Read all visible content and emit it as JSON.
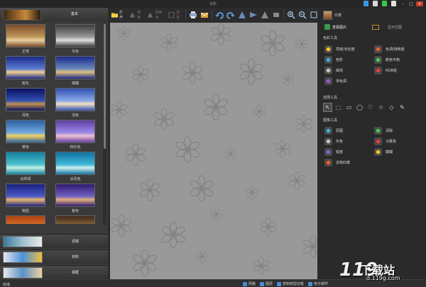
{
  "app": {
    "title": "光影"
  },
  "skin_icons": [
    "#3a9ad8",
    "#d8d8d8",
    "#3ac848",
    "#e0e0e0"
  ],
  "left_panel": {
    "header_label": "基本",
    "presets": [
      {
        "label": "正常",
        "colors": [
          "#7a4a2a",
          "#c0985a",
          "#e8d0a0"
        ]
      },
      {
        "label": "灰色",
        "colors": [
          "#3a3a3a",
          "#9a9a9a",
          "#e0e0e0"
        ]
      },
      {
        "label": "锐化",
        "colors": [
          "#1a2a8a",
          "#5a7ad0",
          "#f0d090"
        ]
      },
      {
        "label": "模糊",
        "colors": [
          "#1a2a8a",
          "#6a8ac0",
          "#e0c080"
        ]
      },
      {
        "label": "深色",
        "colors": [
          "#0a1060",
          "#3050b0",
          "#c09050"
        ]
      },
      {
        "label": "浅色",
        "colors": [
          "#3050b0",
          "#8aa8e8",
          "#f0e0c0"
        ]
      },
      {
        "label": "黄色",
        "colors": [
          "#2a60a0",
          "#70a8e0",
          "#f0d060"
        ]
      },
      {
        "label": "粉红色",
        "colors": [
          "#6040a0",
          "#9a88e8",
          "#f0c0d0"
        ]
      },
      {
        "label": "淡草绿",
        "colors": [
          "#1080a0",
          "#50c0d0",
          "#c0f0e0"
        ]
      },
      {
        "label": "淡青色",
        "colors": [
          "#1070a0",
          "#40b8d8",
          "#d0f0f0"
        ]
      },
      {
        "label": "稍蓝",
        "colors": [
          "#1a2080",
          "#4a5ac8",
          "#e8b870"
        ]
      },
      {
        "label": "紫色",
        "colors": [
          "#301a70",
          "#7060c0",
          "#e0b080"
        ]
      },
      {
        "label": "",
        "colors": [
          "#b04010",
          "#e08030",
          "#f8c860"
        ]
      },
      {
        "label": "",
        "colors": [
          "#402818",
          "#a07848",
          "#f0d8a0"
        ]
      }
    ],
    "categories": [
      {
        "label": "滤镜",
        "colors": [
          "#3a7a9a",
          "#a0c0d0",
          "#e8e8e8"
        ]
      },
      {
        "label": "材料",
        "colors": [
          "#e8e8f0",
          "#4a90d8",
          "#f0c040"
        ]
      },
      {
        "label": "相框",
        "colors": [
          "#e8e8e8",
          "#5a90c8",
          "#f0d0a0"
        ]
      }
    ]
  },
  "toolbar": {
    "open": "打开",
    "save": "保存",
    "save_as": "另存为",
    "text": "文本"
  },
  "right_panel": {
    "user_text": "收藏",
    "tab_active": "查看图片",
    "tab_other": "显示位图",
    "section_color": "色彩工具",
    "color_tools": [
      {
        "label": "亮度/对比度",
        "icon": "sun-icon"
      },
      {
        "label": "色调/饱和度",
        "icon": "palette-icon"
      },
      {
        "label": "色阶",
        "icon": "levels-icon"
      },
      {
        "label": "颜色平衡",
        "icon": "balance-icon"
      },
      {
        "label": "曲线",
        "icon": "curves-icon"
      },
      {
        "label": "RGB值",
        "icon": "rgb-icon"
      },
      {
        "label": "单色调",
        "icon": "monotone-icon"
      }
    ],
    "section_select": "选择工具",
    "select_tools": [
      "↖",
      "⬚",
      "▭",
      "◯",
      "♡",
      "☆",
      "◇",
      "✎"
    ],
    "section_image": "图像工具",
    "image_tools": [
      {
        "label": "原图",
        "icon": "original-icon"
      },
      {
        "label": "清除",
        "icon": "clear-icon"
      },
      {
        "label": "灰色",
        "icon": "gray-icon"
      },
      {
        "label": "马赛克",
        "icon": "mosaic-icon"
      },
      {
        "label": "锐度",
        "icon": "sharpen-icon"
      },
      {
        "label": "模糊",
        "icon": "blur-icon"
      },
      {
        "label": "去除红眼",
        "icon": "redeye-icon"
      }
    ]
  },
  "statusbar": {
    "left_text": "就绪",
    "items": [
      "网格",
      "图层",
      "复制到剪切板",
      "电子邮件"
    ]
  },
  "watermark": {
    "logo": "119",
    "big": "下载站",
    "small": "d.119g.com"
  }
}
